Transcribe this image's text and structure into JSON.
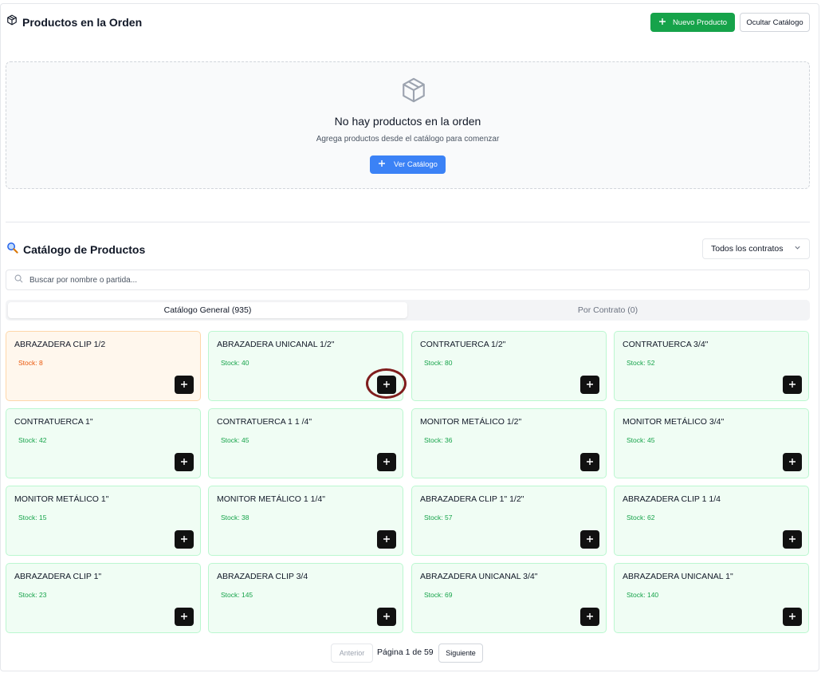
{
  "order": {
    "title": "Productos en la Orden",
    "new_product_label": "Nuevo Producto",
    "hide_catalog_label": "Ocultar Catálogo",
    "empty_title": "No hay productos en la orden",
    "empty_subtitle": "Agrega productos desde el catálogo para comenzar",
    "view_catalog_label": "Ver Catálogo"
  },
  "catalog": {
    "title": "Catálogo de Productos",
    "contract_filter": "Todos los contratos",
    "search_placeholder": "Buscar por nombre o partida...",
    "tabs": [
      {
        "label": "Catálogo General (935)",
        "active": true
      },
      {
        "label": "Por Contrato (0)",
        "active": false
      }
    ],
    "products": [
      {
        "name": "ABRAZADERA CLIP 1/2",
        "stock": "Stock: 8",
        "low": true
      },
      {
        "name": "ABRAZADERA UNICANAL 1/2\"",
        "stock": "Stock: 40",
        "low": false
      },
      {
        "name": "CONTRATUERCA 1/2\"",
        "stock": "Stock: 80",
        "low": false
      },
      {
        "name": "CONTRATUERCA 3/4\"",
        "stock": "Stock: 52",
        "low": false
      },
      {
        "name": "CONTRATUERCA 1\"",
        "stock": "Stock: 42",
        "low": false
      },
      {
        "name": "CONTRATUERCA 1 1 /4\"",
        "stock": "Stock: 45",
        "low": false
      },
      {
        "name": "MONITOR METÁLICO 1/2\"",
        "stock": "Stock: 36",
        "low": false
      },
      {
        "name": "MONITOR METÁLICO 3/4\"",
        "stock": "Stock: 45",
        "low": false
      },
      {
        "name": "MONITOR METÁLICO 1\"",
        "stock": "Stock: 15",
        "low": false
      },
      {
        "name": "MONITOR METÁLICO 1 1/4\"",
        "stock": "Stock: 38",
        "low": false
      },
      {
        "name": "ABRAZADERA CLIP 1\" 1/2\"",
        "stock": "Stock: 57",
        "low": false
      },
      {
        "name": "ABRAZADERA CLIP 1 1/4",
        "stock": "Stock: 62",
        "low": false
      },
      {
        "name": "ABRAZADERA CLIP 1\"",
        "stock": "Stock: 23",
        "low": false
      },
      {
        "name": "ABRAZADERA CLIP 3/4",
        "stock": "Stock: 145",
        "low": false
      },
      {
        "name": "ABRAZADERA UNICANAL 3/4\"",
        "stock": "Stock: 69",
        "low": false
      },
      {
        "name": "ABRAZADERA UNICANAL 1\"",
        "stock": "Stock: 140",
        "low": false
      }
    ]
  },
  "pagination": {
    "prev_label": "Anterior",
    "page_info": "Página 1 de 59",
    "next_label": "Siguiente"
  },
  "colors": {
    "green": "#16a34a",
    "blue": "#3b82f6",
    "low_stock": "#ea580c",
    "highlight": "#7f1d1d"
  }
}
